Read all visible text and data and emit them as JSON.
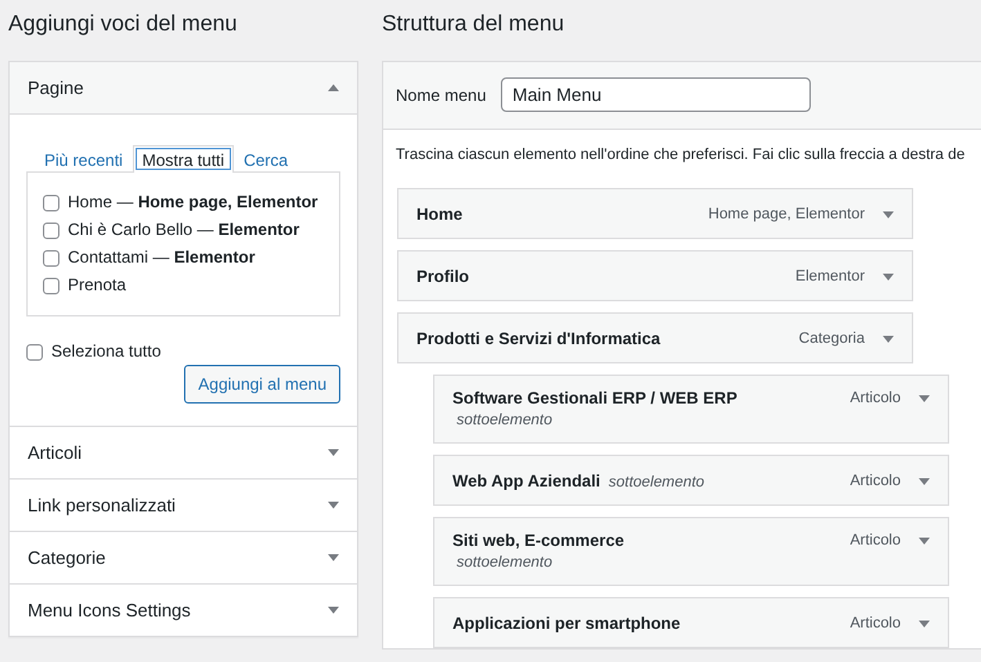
{
  "add_items": {
    "title": "Aggiungi voci del menu",
    "sections": [
      {
        "label": "Pagine",
        "expanded": true,
        "tabs": [
          {
            "label": "Più recenti",
            "selected": false
          },
          {
            "label": "Mostra tutti",
            "selected": true
          },
          {
            "label": "Cerca",
            "selected": false
          }
        ],
        "pages": [
          {
            "label": "Home — **Home page, Elementor**",
            "checked": false
          },
          {
            "label": "Chi è Carlo Bello — **Elementor**",
            "checked": false
          },
          {
            "label": "Contattami — **Elementor**",
            "checked": false
          },
          {
            "label": "Prenota",
            "checked": false
          }
        ],
        "select_all": {
          "label": "Seleziona tutto",
          "checked": false
        },
        "button": "Aggiungi al menu"
      },
      {
        "label": "Articoli",
        "expanded": false
      },
      {
        "label": "Link personalizzati",
        "expanded": false
      },
      {
        "label": "Categorie",
        "expanded": false
      },
      {
        "label": "Menu Icons Settings",
        "expanded": false
      }
    ]
  },
  "structure": {
    "title": "Struttura del menu",
    "name_label": "Nome menu",
    "name_value": "Main Menu",
    "instructions": "Trascina ciascun elemento nell'ordine che preferisci. Fai clic sulla freccia a destra de",
    "items": [
      {
        "title": "Home",
        "type": "Home page, Elementor"
      },
      {
        "title": "Profilo",
        "type": "Elementor"
      },
      {
        "title": "Prodotti e Servizi d'Informatica",
        "type": "Categoria",
        "children": [
          {
            "title": "Software Gestionali ERP / WEB ERP",
            "subtitle": "sottoelemento",
            "subtitle_wrapped": true,
            "type": "Articolo"
          },
          {
            "title": "Web App Aziendali",
            "subtitle": "sottoelemento",
            "subtitle_wrapped": false,
            "type": "Articolo"
          },
          {
            "title": "Siti web, E-commerce",
            "subtitle": "sottoelemento",
            "subtitle_wrapped": true,
            "type": "Articolo"
          },
          {
            "title": "Applicazioni per smartphone",
            "type": "Articolo"
          }
        ]
      }
    ]
  }
}
